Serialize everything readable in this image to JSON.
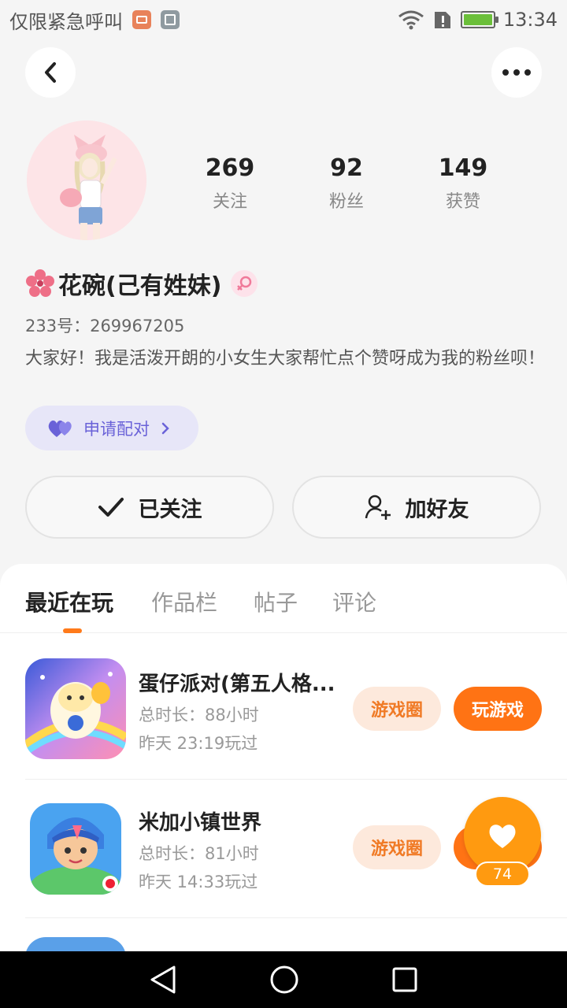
{
  "status_bar": {
    "carrier": "仅限紧急呼叫",
    "time": "13:34"
  },
  "profile": {
    "stats": [
      {
        "value": "269",
        "label": "关注"
      },
      {
        "value": "92",
        "label": "粉丝"
      },
      {
        "value": "149",
        "label": "获赞"
      }
    ],
    "name": "花碗(己有姓妹)",
    "uid": "233号：269967205",
    "bio": "大家好！我是活泼开朗的小女生大家帮忙点个赞呀成为我的粉丝呗！",
    "pair_label": "申请配对",
    "follow_label": "已关注",
    "add_friend_label": "加好友"
  },
  "tabs": [
    "最近在玩",
    "作品栏",
    "帖子",
    "评论"
  ],
  "games": [
    {
      "title": "蛋仔派对(第五人格...",
      "duration": "总时长：88小时",
      "last_played": "昨天 23:19玩过",
      "circle_label": "游戏圈",
      "play_label": "玩游戏"
    },
    {
      "title": "米加小镇世界",
      "duration": "总时长：81小时",
      "last_played": "昨天 14:33玩过",
      "circle_label": "游戏圈",
      "play_label": "玩游戏"
    }
  ],
  "float_like": {
    "count": "74"
  },
  "colors": {
    "accent": "#ff7314",
    "pair_purple": "#6a62d8",
    "float_orange": "#ff9a10"
  }
}
